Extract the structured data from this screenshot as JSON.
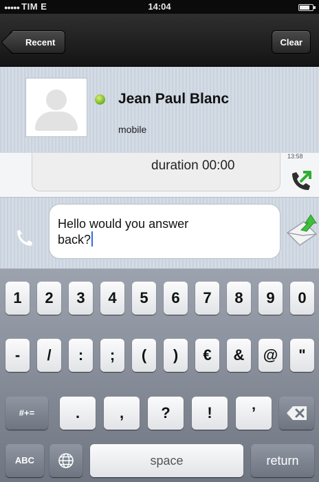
{
  "status_bar": {
    "carrier": "TIM",
    "network": "E",
    "time": "14:04"
  },
  "nav": {
    "back_label": "Recent",
    "clear_label": "Clear"
  },
  "contact": {
    "name": "Jean Paul Blanc",
    "subtitle": "mobile",
    "presence_color": "#7cb82a"
  },
  "message": {
    "duration": "duration 00:00",
    "time": "13:58"
  },
  "composer": {
    "text": "Hello would you answer back?",
    "text_line1": "Hello would you answer",
    "text_line2": "back?"
  },
  "keyboard": {
    "row1": [
      "1",
      "2",
      "3",
      "4",
      "5",
      "6",
      "7",
      "8",
      "9",
      "0"
    ],
    "row2": [
      "-",
      "/",
      ":",
      ";",
      "(",
      ")",
      "€",
      "&",
      "@",
      "\""
    ],
    "row3_left": "#+=",
    "row3": [
      ".",
      ",",
      "?",
      "!",
      "’"
    ],
    "abc": "ABC",
    "space": "space",
    "return": "return"
  },
  "colors": {
    "accent": "#2d6cdf",
    "call_arrow": "#2fae2f"
  },
  "icons": [
    "person-placeholder-icon",
    "presence-dot-icon",
    "outgoing-call-icon",
    "phone-icon",
    "send-message-icon",
    "globe-icon",
    "backspace-icon"
  ]
}
